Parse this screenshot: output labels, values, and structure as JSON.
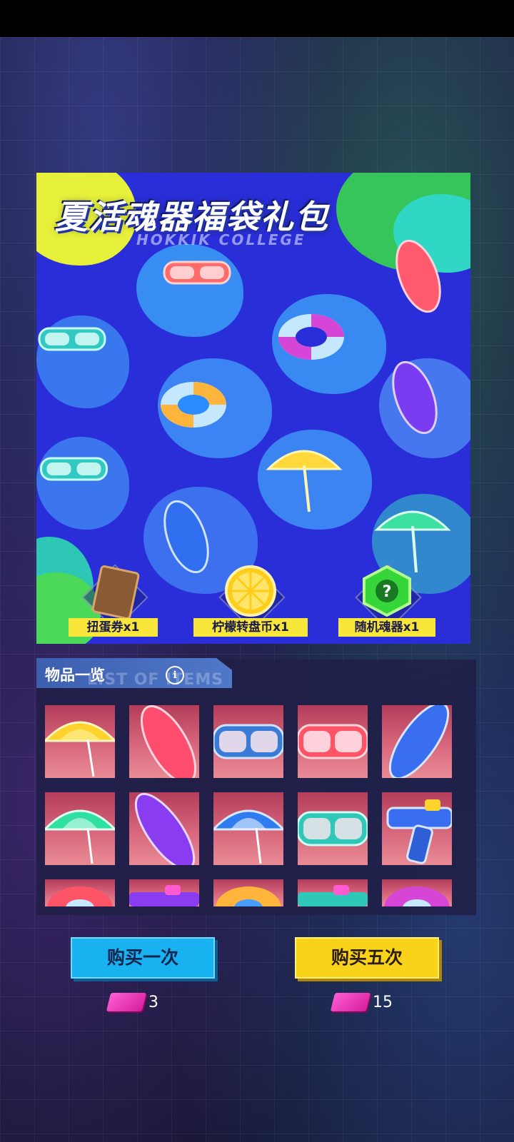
{
  "banner": {
    "title": "夏活魂器福袋礼包",
    "subtitle": "HOKKIK COLLEGE",
    "rewards": [
      {
        "label": "扭蛋券x1",
        "icon": "gacha-ticket-icon"
      },
      {
        "label": "柠檬转盘币x1",
        "icon": "lemon-coin-icon"
      },
      {
        "label": "随机魂器x1",
        "icon": "random-relic-icon"
      }
    ]
  },
  "item_list": {
    "title": "物品一览",
    "subtitle": "LIST OF ITEMS",
    "info_icon": "i",
    "items": [
      "yellow-umbrella",
      "red-surfboard",
      "blue-goggles",
      "red-goggles",
      "blue-surfboard",
      "green-umbrella",
      "purple-surfboard",
      "blue-umbrella",
      "teal-goggles",
      "water-gun",
      "swim-ring",
      "water-gun-green",
      "swim-ring-yellow",
      "water-gun-teal",
      "swim-ring-purple"
    ]
  },
  "buy_once": {
    "label": "购买一次",
    "cost": "3"
  },
  "buy_five": {
    "label": "购买五次",
    "cost": "15"
  },
  "colors": {
    "once": "#17b2ef",
    "five": "#f9d31a",
    "ticket": "#e436b8"
  }
}
